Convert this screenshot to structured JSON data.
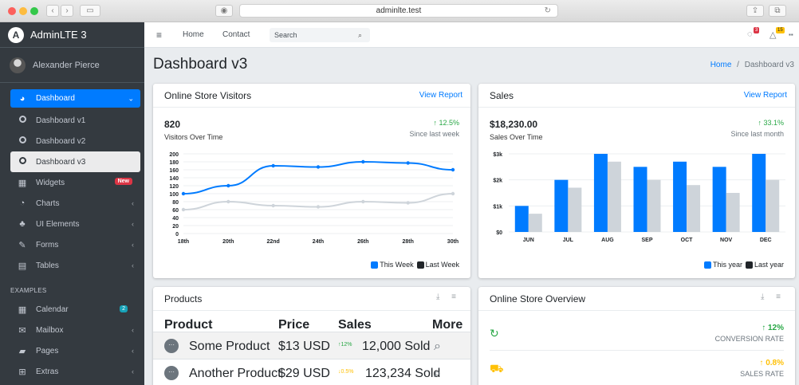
{
  "browser": {
    "address": "adminlte.test",
    "nav_back": "‹",
    "nav_forward": "›",
    "sidebar_toggle": "▭",
    "lock_glyph": "◉",
    "reload": "↻",
    "share": "⇪",
    "tabs": "⧉"
  },
  "brand": {
    "name": "AdminLTE 3",
    "logo_letter": "A"
  },
  "user": {
    "name": "Alexander Pierce"
  },
  "sidebar": {
    "items": [
      {
        "label": "Dashboard",
        "icon": "tachometer-icon",
        "glyph": "◕",
        "right": "⌄"
      },
      {
        "label": "Dashboard v1",
        "icon": "circle-icon"
      },
      {
        "label": "Dashboard v2",
        "icon": "circle-icon"
      },
      {
        "label": "Dashboard v3",
        "icon": "circle-icon"
      },
      {
        "label": "Widgets",
        "icon": "th-icon",
        "glyph": "▦",
        "badge": "New"
      },
      {
        "label": "Charts",
        "icon": "pie-chart-icon",
        "glyph": "◔",
        "right": "‹"
      },
      {
        "label": "UI Elements",
        "icon": "tree-icon",
        "glyph": "♣",
        "right": "‹"
      },
      {
        "label": "Forms",
        "icon": "edit-icon",
        "glyph": "✎",
        "right": "‹"
      },
      {
        "label": "Tables",
        "icon": "table-icon",
        "glyph": "▤",
        "right": "‹"
      }
    ],
    "section_header": "EXAMPLES",
    "examples": [
      {
        "label": "Calendar",
        "icon": "calendar-icon",
        "glyph": "▦",
        "badge": "2"
      },
      {
        "label": "Mailbox",
        "icon": "envelope-icon",
        "glyph": "✉",
        "right": "‹"
      },
      {
        "label": "Pages",
        "icon": "book-icon",
        "glyph": "▰",
        "right": "‹"
      },
      {
        "label": "Extras",
        "icon": "plus-square-icon",
        "glyph": "⊞",
        "right": "‹"
      }
    ]
  },
  "topnav": {
    "menu_glyph": "≡",
    "links": [
      "Home",
      "Contact"
    ],
    "search_placeholder": "Search",
    "search_glyph": "⌕",
    "messages_glyph": "◌",
    "messages_badge": "3",
    "notifications_glyph": "△",
    "notifications_badge": "15",
    "apps_glyph": "▪▪"
  },
  "page": {
    "title": "Dashboard v3",
    "breadcrumb_home": "Home",
    "breadcrumb_sep": "/",
    "breadcrumb_current": "Dashboard v3"
  },
  "visitors_card": {
    "title": "Online Store Visitors",
    "link": "View Report",
    "value": "820",
    "label": "Visitors Over Time",
    "change": "↑ 12.5%",
    "change_note": "Since last week",
    "colors": {
      "this_week": "#007bff",
      "last_week": "#ced4da"
    }
  },
  "sales_card": {
    "title": "Sales",
    "link": "View Report",
    "value": "$18,230.00",
    "label": "Sales Over Time",
    "change": "↑ 33.1%",
    "change_note": "Since last month",
    "colors": {
      "this_year": "#007bff",
      "last_year": "#ced4da"
    }
  },
  "products_card": {
    "title": "Products",
    "tools": "⤓ ≡",
    "headers": [
      "Product",
      "Price",
      "Sales",
      "More"
    ],
    "rows": [
      {
        "name": "Some Product",
        "price": "$13 USD",
        "change": "↑12%",
        "sold": "12,000 Sold",
        "change_color": "#28a745"
      },
      {
        "name": "Another Product",
        "price": "$29 USD",
        "change": "↓0.5%",
        "sold": "123,234 Sold",
        "change_color": "#ffc107"
      }
    ],
    "more_glyph": "⌕",
    "avatar_glyph": "···"
  },
  "overview_card": {
    "title": "Online Store Overview",
    "tools": "⤓ ≡",
    "rows": [
      {
        "icon": "refresh-icon",
        "glyph": "↻",
        "icon_color": "#28a745",
        "pct": "↑ 12%",
        "pct_color": "#28a745",
        "label": "CONVERSION RATE"
      },
      {
        "icon": "cart-icon",
        "glyph": "⛟",
        "icon_color": "#ffc107",
        "pct": "↑ 0.8%",
        "pct_color": "#ffc107",
        "label": "SALES RATE"
      }
    ]
  },
  "chart_data": [
    {
      "type": "line",
      "x": [
        "18th",
        "20th",
        "22nd",
        "24th",
        "26th",
        "28th",
        "30th"
      ],
      "ylim": [
        0,
        200
      ],
      "yticks": [
        0,
        20,
        40,
        60,
        80,
        100,
        120,
        140,
        160,
        180,
        200
      ],
      "series": [
        {
          "name": "This Week",
          "values": [
            100,
            120,
            170,
            167,
            180,
            177,
            160
          ],
          "color": "#007bff"
        },
        {
          "name": "Last Week",
          "values": [
            60,
            80,
            70,
            67,
            80,
            77,
            100
          ],
          "color": "#ced4da"
        }
      ],
      "legend": "bottom-right",
      "grid": true
    },
    {
      "type": "bar",
      "categories": [
        "JUN",
        "JUL",
        "AUG",
        "SEP",
        "OCT",
        "NOV",
        "DEC"
      ],
      "ylim": [
        0,
        3000
      ],
      "ytick_labels": [
        "$0",
        "$1k",
        "$2k",
        "$3k"
      ],
      "yticks": [
        0,
        1000,
        2000,
        3000
      ],
      "series": [
        {
          "name": "This year",
          "values": [
            1000,
            2000,
            3000,
            2500,
            2700,
            2500,
            3000
          ],
          "color": "#007bff"
        },
        {
          "name": "Last year",
          "values": [
            700,
            1700,
            2700,
            2000,
            1800,
            1500,
            2000
          ],
          "color": "#ced4da"
        }
      ],
      "legend": "bottom-right",
      "grid": true
    }
  ]
}
